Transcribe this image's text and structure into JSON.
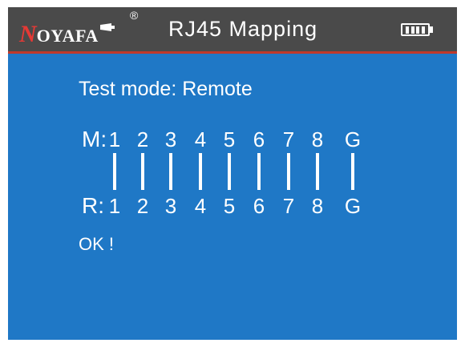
{
  "header": {
    "brand_first": "N",
    "brand_rest": "OYAFA",
    "brand_reg": "®",
    "title": "RJ45 Mapping",
    "battery_icon": "battery-full-icon"
  },
  "test": {
    "mode_label": "Test mode: Remote",
    "m_label": "M:",
    "r_label": "R:",
    "m_pins": [
      "1",
      "2",
      "3",
      "4",
      "5",
      "6",
      "7",
      "8",
      "G"
    ],
    "r_pins": [
      "1",
      "2",
      "3",
      "4",
      "5",
      "6",
      "7",
      "8",
      "G"
    ],
    "result": "OK !"
  },
  "colors": {
    "screen_bg": "#1f78c6",
    "header_bg": "#4a4a4a",
    "accent_red": "#c0392b",
    "text": "#ffffff"
  }
}
